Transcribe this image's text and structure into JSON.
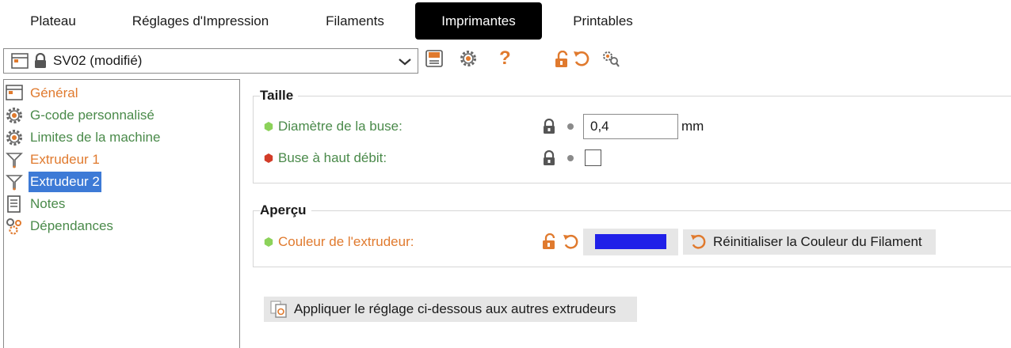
{
  "tabs": [
    "Plateau",
    "Réglages d'Impression",
    "Filaments",
    "Imprimantes",
    "Printables"
  ],
  "active_tab": "Imprimantes",
  "preset": {
    "name": "SV02 (modifié)",
    "icons": [
      "printer-preset-icon",
      "lock-icon",
      "chevron-down-icon"
    ]
  },
  "toolbar_icons": [
    "save-icon",
    "gear-icon",
    "question-icon",
    "unlock-icon",
    "undo-icon",
    "search-settings-icon"
  ],
  "tree": {
    "items": [
      {
        "label": "Général",
        "icon": "general-icon",
        "color": "#e07a2e"
      },
      {
        "label": "G-code personnalisé",
        "icon": "gear-icon",
        "color": "#4a8a4a"
      },
      {
        "label": "Limites de la machine",
        "icon": "gear-icon",
        "color": "#4a8a4a"
      },
      {
        "label": "Extrudeur 1",
        "icon": "extruder-icon",
        "color": "#e07a2e"
      },
      {
        "label": "Extrudeur 2",
        "icon": "extruder-icon",
        "color": "#e07a2e"
      },
      {
        "label": "Notes",
        "icon": "notes-icon",
        "color": "#4a8a4a"
      },
      {
        "label": "Dépendances",
        "icon": "dependencies-icon",
        "color": "#4a8a4a"
      }
    ],
    "selected": "Extrudeur 2"
  },
  "size_group": {
    "title": "Taille",
    "nozzle_label": "Diamètre de la buse:",
    "nozzle_value": "0,4",
    "nozzle_unit": "mm",
    "high_flow_label": "Buse à haut débit:",
    "high_flow_checked": false
  },
  "preview_group": {
    "title": "Aperçu",
    "color_label": "Couleur de l'extrudeur:",
    "swatch_color": "#2020e8",
    "reset_button": "Réinitialiser la Couleur du Filament"
  },
  "apply_button": "Appliquer le réglage ci-dessous aux autres extrudeurs",
  "colors": {
    "orange": "#e07a2e",
    "green_dot": "#8cd25a",
    "red_dot": "#d23c28",
    "selection": "#3d7ad6"
  }
}
